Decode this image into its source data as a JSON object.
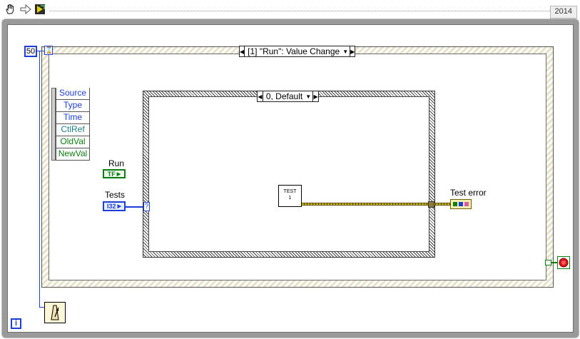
{
  "toolbar": {
    "year_badge": "2014",
    "tools": [
      {
        "name": "hand-tool-icon"
      },
      {
        "name": "arrow-tool-icon"
      },
      {
        "name": "run-highlight-icon"
      }
    ]
  },
  "while_loop": {
    "timeout_constant": "50",
    "timeout_terminal": "⌛",
    "iteration_terminal": "i"
  },
  "event_structure": {
    "selector_label": "[1] \"Run\": Value Change",
    "event_data": [
      "Source",
      "Type",
      "Time",
      "CtlRef",
      "OldVal",
      "NewVal"
    ]
  },
  "case_structure": {
    "selector_label": "0, Default",
    "selector_terminal": "?",
    "subvi_label_line1": "TEST",
    "subvi_label_line2": "1"
  },
  "controls": {
    "run_label": "Run",
    "run_type": "TF",
    "tests_label": "Tests",
    "tests_type": "I32",
    "test_error_label": "Test error"
  },
  "colors": {
    "int_wire": "#1c3edb",
    "bool_wire": "#0e7d10",
    "error_wire": "#d6c200",
    "stop_red": "#e0141b"
  }
}
